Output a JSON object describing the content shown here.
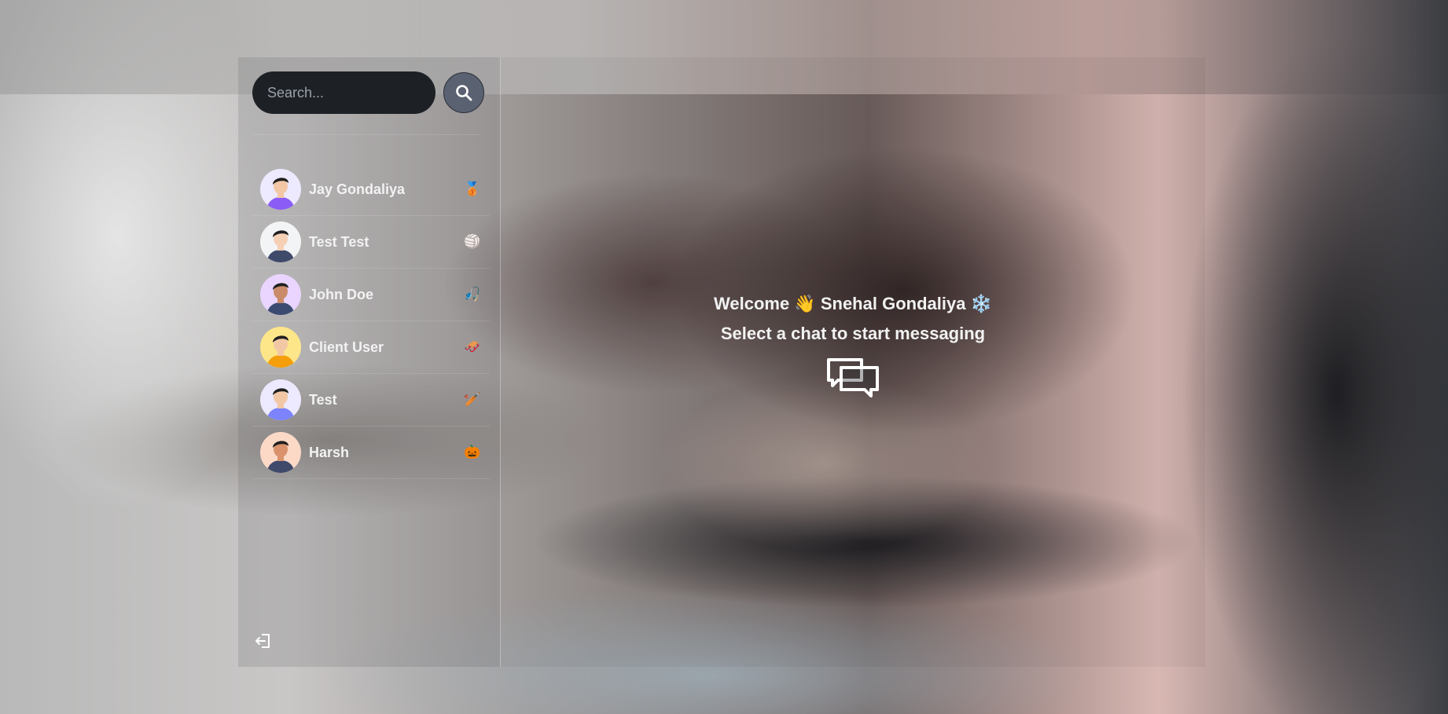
{
  "search": {
    "placeholder": "Search..."
  },
  "chats": [
    {
      "name": "Jay Gondaliya",
      "emoji": "🥉",
      "avatar_shirt": "#8b5cf6",
      "avatar_skin": "#f2c7a5",
      "avatar_bg": "#ede9fe"
    },
    {
      "name": "Test Test",
      "emoji": "🏐",
      "avatar_shirt": "#3f4a6b",
      "avatar_skin": "#f5d0b5",
      "avatar_bg": "#f3f4f6"
    },
    {
      "name": "John Doe",
      "emoji": "🎣",
      "avatar_shirt": "#3b4a70",
      "avatar_skin": "#c98b6a",
      "avatar_bg": "#e9d5ff"
    },
    {
      "name": "Client User",
      "emoji": "🛷",
      "avatar_shirt": "#f59e0b",
      "avatar_skin": "#f2c7a5",
      "avatar_bg": "#fde68a"
    },
    {
      "name": "Test",
      "emoji": "🏏",
      "avatar_shirt": "#7c83fd",
      "avatar_skin": "#f2c7a5",
      "avatar_bg": "#ede9fe"
    },
    {
      "name": "Harsh",
      "emoji": "🎃",
      "avatar_shirt": "#3f4a6b",
      "avatar_skin": "#d9926b",
      "avatar_bg": "#fcd9c7"
    }
  ],
  "main": {
    "welcome": "Welcome 👋 Snehal Gondaliya ❄️",
    "subtitle": "Select a chat to start messaging"
  },
  "icons": {
    "search": "search-icon",
    "logout": "logout-icon",
    "chat": "chat-bubbles-icon"
  },
  "colors": {
    "search_bg": "#1d2126",
    "search_button": "#5a6170",
    "text": "#f2f2f2"
  }
}
